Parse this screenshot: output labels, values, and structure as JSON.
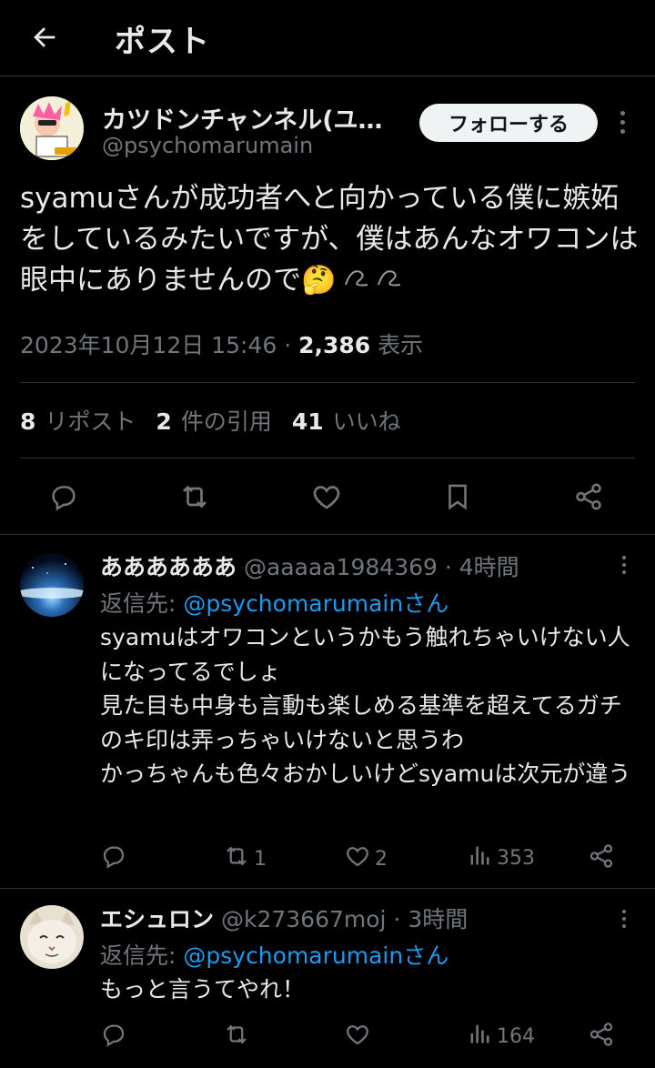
{
  "header": {
    "title": "ポスト"
  },
  "post": {
    "author_name": "カツドンチャンネル(ユ…",
    "author_handle": "@psychomarumain",
    "follow_label": "フォローする",
    "text": "syamuさんが成功者へと向かっている僕に嫉妬をしているみたいですが、僕はあんなオワコンは眼中にありませんので🤔",
    "date": "2023年10月12日 15:46",
    "separator": " · ",
    "views": "2,386",
    "views_label": " 表示",
    "reposts": "8",
    "reposts_label": "リポスト",
    "quotes": "2",
    "quotes_label": "件の引用",
    "likes": "41",
    "likes_label": "いいね"
  },
  "replies": [
    {
      "name": "ああああああ",
      "handle": "@aaaaa1984369",
      "time": "· 4時間",
      "reply_to_label": "返信先: ",
      "reply_to_mention": "@psychomarumainさん",
      "text": "syamuはオワコンというかもう触れちゃいけない人になってるでしょ\n見た目も中身も言動も楽しめる基準を超えてるガチのキ印は弄っちゃいけないと思うわ\nかっちゃんも色々おかしいけどsyamuは次元が違う",
      "retweets": "1",
      "likes": "2",
      "views": "353"
    },
    {
      "name": "エシュロン",
      "handle": "@k273667moj",
      "time": "· 3時間",
      "reply_to_label": "返信先: ",
      "reply_to_mention": "@psychomarumainさん",
      "text": "もっと言うてやれ！",
      "retweets": "",
      "likes": "",
      "views": "164"
    }
  ],
  "colors": {
    "accent": "#1d9bf0",
    "muted": "#71767b",
    "background": "#000000",
    "text": "#e7e9ea"
  }
}
